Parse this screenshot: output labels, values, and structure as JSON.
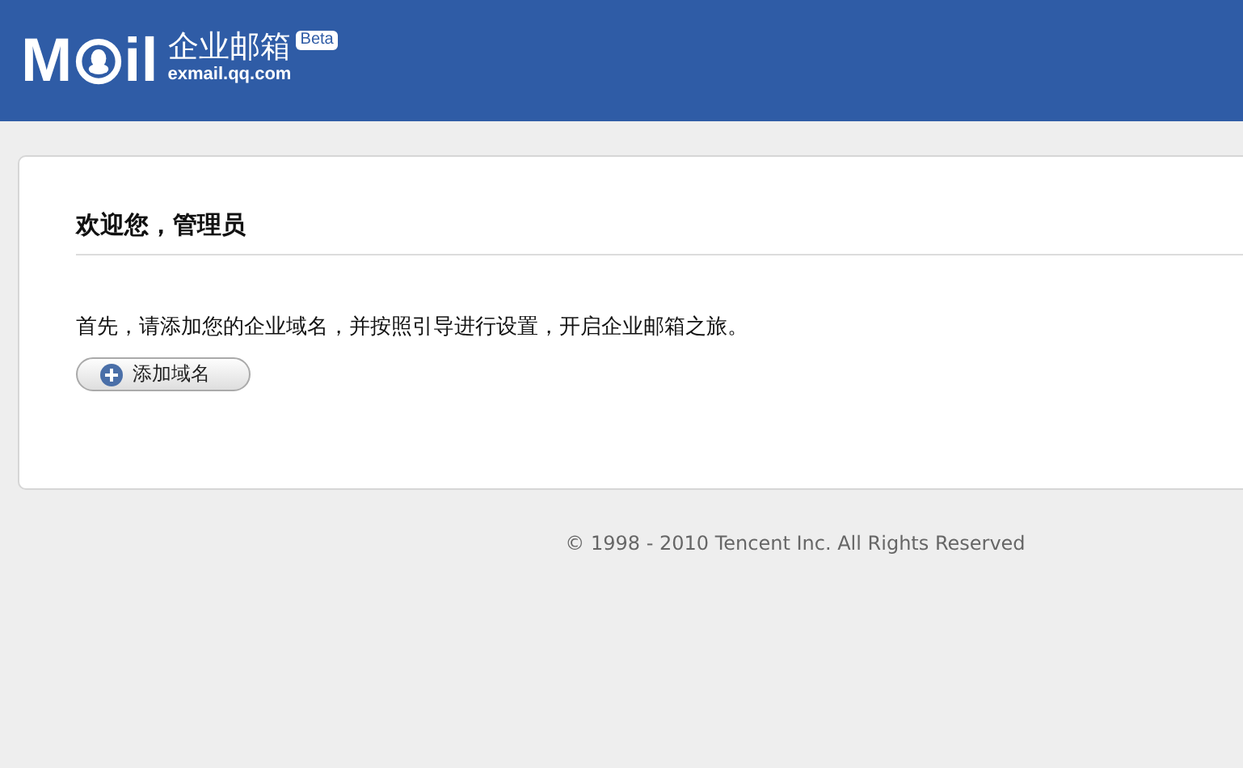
{
  "header": {
    "logo_left": "M",
    "logo_right": "il",
    "product": "企业邮箱",
    "domain": "exmail.qq.com",
    "badge": "Beta"
  },
  "card": {
    "title": "欢迎您，管理员",
    "text": "首先，请添加您的企业域名，并按照引导进行设置，开启企业邮箱之旅。",
    "button": "添加域名"
  },
  "footer": "© 1998 - 2010 Tencent Inc. All Rights Reserved"
}
